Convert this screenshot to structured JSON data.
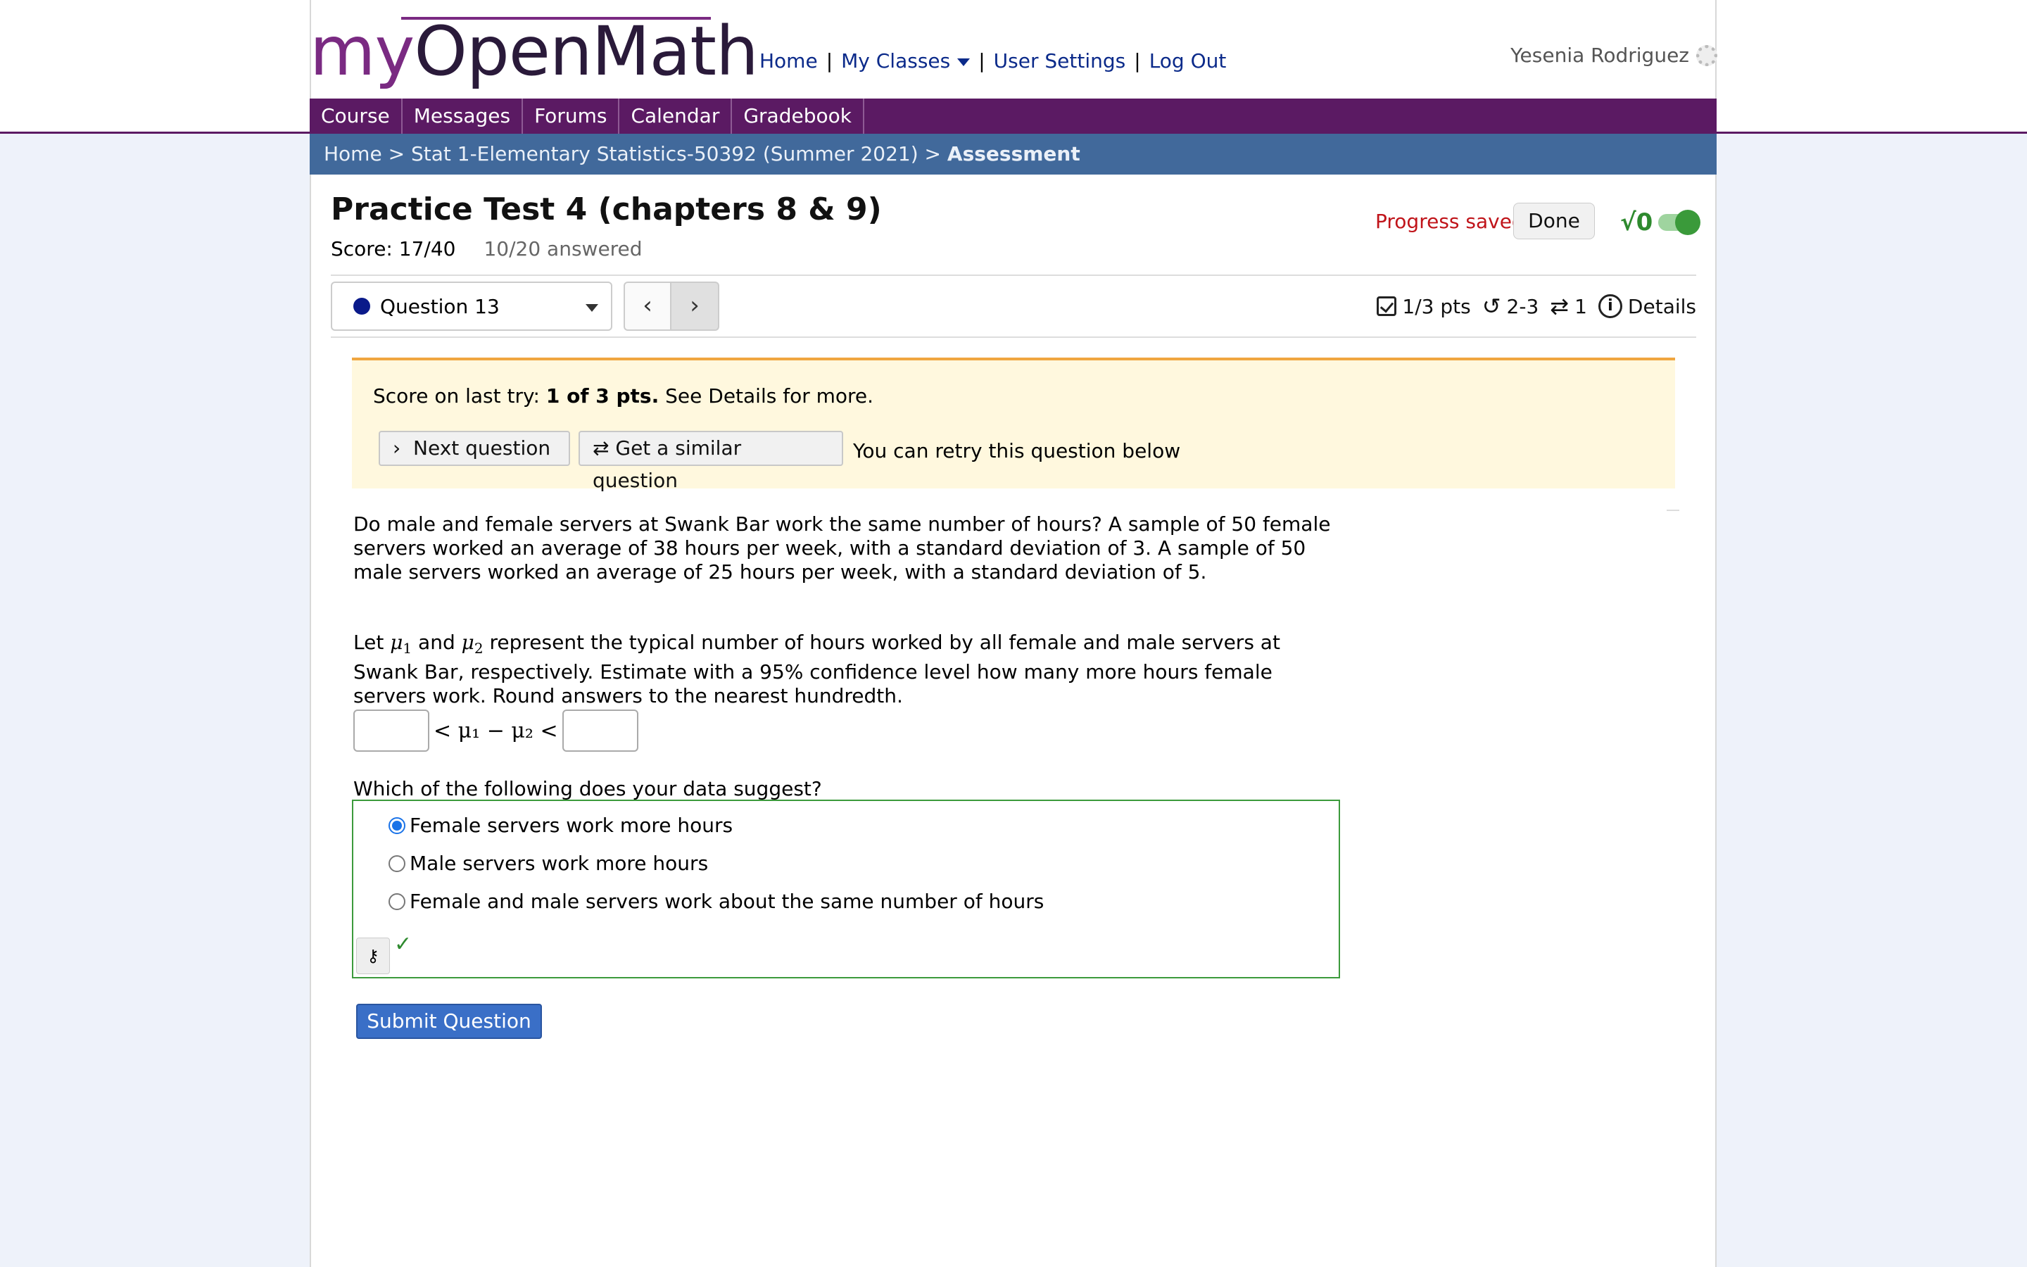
{
  "header": {
    "logo_my": "my",
    "logo_rest": "OpenMath",
    "nav": [
      "Home",
      "My Classes",
      "User Settings",
      "Log Out"
    ],
    "user_name": "Yesenia Rodriguez"
  },
  "course_nav": [
    "Course",
    "Messages",
    "Forums",
    "Calendar",
    "Gradebook"
  ],
  "breadcrumb": {
    "home": "Home",
    "course": "Stat 1-Elementary Statistics-50392 (Summer 2021)",
    "current": "Assessment",
    "sep": ">"
  },
  "assessment": {
    "title": "Practice Test 4 (chapters 8 & 9)",
    "score": "Score: 17/40",
    "answered": "10/20 answered",
    "progress_status": "Progress saved",
    "done_label": "Done",
    "math_toggle_label": "√0"
  },
  "question_nav": {
    "selected": "Question 13",
    "prev_glyph": "‹",
    "next_glyph": "›",
    "points": "1/3 pts",
    "attempts": "2-3",
    "regens": "1",
    "details_label": "Details"
  },
  "feedback": {
    "prefix": "Score on last try: ",
    "score": "1 of 3 pts.",
    "suffix": " See Details for more.",
    "next_label": "Next question",
    "similar_label": "Get a similar question",
    "retry_note": "You can retry this question below"
  },
  "question": {
    "para1": "Do male and female servers at Swank Bar work the same number of hours? A sample of 50 female servers worked an average of 38 hours per week, with a standard deviation of 3. A sample of 50 male servers worked an average of 25 hours per week, with a standard deviation of 5.",
    "para2_before": "Let ",
    "para2_and": " and ",
    "para2_after": " represent the typical number of hours worked by all female and male servers at Swank Bar, respectively. Estimate with a 95% confidence level how many more hours female servers work. Round answers to the nearest hundredth.",
    "mu": "μ",
    "sub1": "1",
    "sub2": "2",
    "inequality": "< μ₁ − μ₂ <",
    "lower_value": "",
    "upper_value": "",
    "prompt": "Which of the following does your data suggest?",
    "choices": [
      "Female servers work more hours",
      "Male servers work more hours",
      "Female and male servers work about the same number of hours"
    ],
    "selected_choice": 0,
    "submit_label": "Submit Question"
  },
  "colors": {
    "brand_purple": "#5b1a63",
    "breadcrumb_blue": "#41699b",
    "link_blue": "#0b2a8a",
    "correct_green": "#3c9a3c",
    "progress_red": "#c0141a",
    "submit_blue": "#3a6fc7"
  }
}
